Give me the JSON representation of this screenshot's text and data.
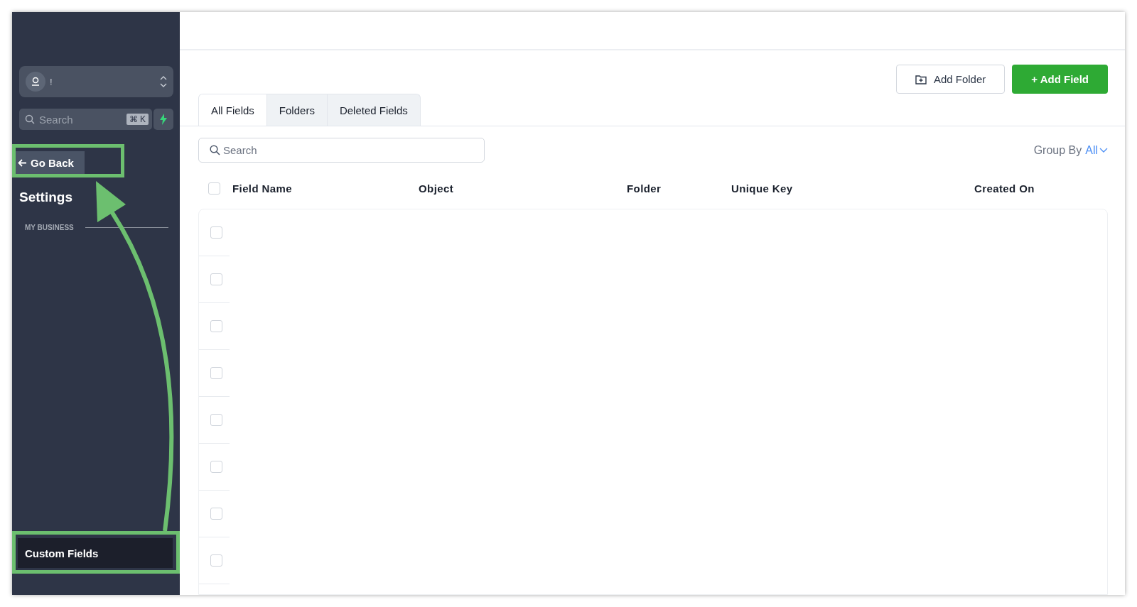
{
  "sidebar": {
    "account": {
      "name": "!"
    },
    "search": {
      "placeholder": "Search",
      "shortcut": "⌘ K"
    },
    "back": "Go Back",
    "title": "Settings",
    "section": "MY BUSINESS",
    "items": [
      {
        "label": "Custom Fields",
        "selected": true
      }
    ]
  },
  "toolbar": {
    "buttons": [
      {
        "label": "Add Folder",
        "kind": "secondary"
      },
      {
        "label": "+ Add Field",
        "kind": "primary"
      }
    ]
  },
  "tabs": [
    {
      "label": "All Fields",
      "selected": true
    },
    {
      "label": "Folders",
      "selected": false
    },
    {
      "label": "Deleted Fields",
      "selected": false
    }
  ],
  "search": {
    "placeholder": "Search"
  },
  "group_by": {
    "label": "Group By",
    "value": "All"
  },
  "table": {
    "columns": [
      "Field Name",
      "Object",
      "Folder",
      "Unique Key",
      "Created On"
    ],
    "header_checked": false,
    "rows": [
      {
        "checked": false
      },
      {
        "checked": false
      },
      {
        "checked": false
      },
      {
        "checked": false
      },
      {
        "checked": false
      },
      {
        "checked": false
      },
      {
        "checked": false
      },
      {
        "checked": false
      }
    ]
  }
}
